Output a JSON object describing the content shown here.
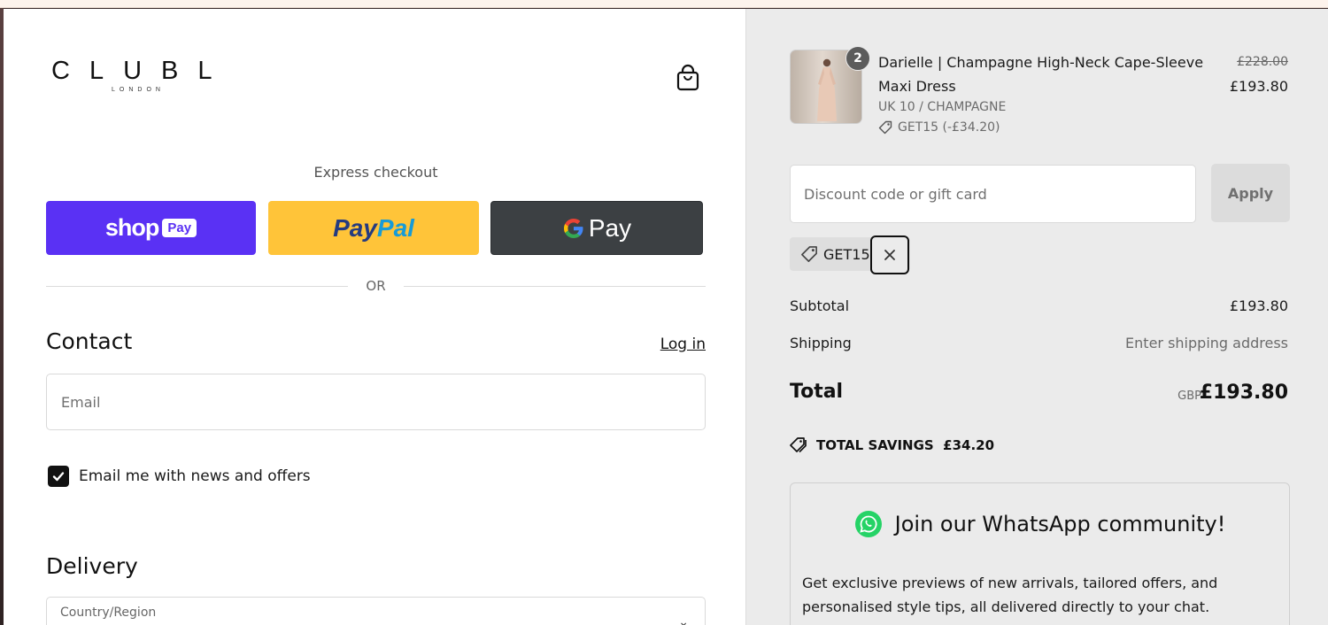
{
  "brand": {
    "logo_main": "CLUBL",
    "logo_sub": "LONDON"
  },
  "express": {
    "label": "Express checkout",
    "shop_text": "shop",
    "shop_badge": "Pay",
    "paypal_part1": "Pay",
    "paypal_part2": "Pal",
    "gpay_text": "Pay",
    "shop_color": "#5a31f4",
    "paypal_color": "#ffc439",
    "gpay_color": "#3c4043"
  },
  "divider": {
    "or_text": "OR"
  },
  "contact": {
    "heading": "Contact",
    "login_label": "Log in",
    "email_placeholder": "Email",
    "newsletter_label": "Email me with news and offers",
    "newsletter_checked": true
  },
  "delivery": {
    "heading": "Delivery",
    "country_label": "Country/Region"
  },
  "order": {
    "item": {
      "quantity": "2",
      "title": "Darielle | Champagne High-Neck Cape-Sleeve Maxi Dress",
      "variant": "UK 10 / CHAMPAGNE",
      "discount": "GET15 (-£34.20)",
      "price_original": "£228.00",
      "price_current": "£193.80"
    },
    "discount_placeholder": "Discount code or gift card",
    "apply_label": "Apply",
    "applied_code": "GET15",
    "subtotal_label": "Subtotal",
    "subtotal_value": "£193.80",
    "shipping_label": "Shipping",
    "shipping_value": "Enter shipping address",
    "total_label": "Total",
    "total_currency": "GBP",
    "total_value": "£193.80",
    "savings_text": "TOTAL SAVINGS  £34.20"
  },
  "whatsapp": {
    "title": "Join our WhatsApp community!",
    "body": "Get exclusive previews of new arrivals, tailored offers, and personalised style tips, all delivered directly to your chat.",
    "icon_color": "#25d366"
  },
  "icons": [
    "shopping-bag-icon",
    "google-g-icon",
    "checkmark-icon",
    "tag-icon",
    "close-icon",
    "savings-tag-icon",
    "whatsapp-icon",
    "chevron-down-icon"
  ]
}
